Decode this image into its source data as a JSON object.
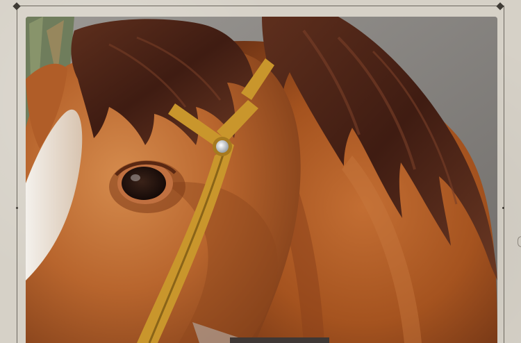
{
  "image": {
    "subject": "horse-head-sculpture",
    "palette": {
      "background": "#d6d1c7",
      "frame": "#6b665d",
      "coat_light": "#c97a3c",
      "coat_mid": "#a85a27",
      "coat_dark": "#5a2a14",
      "mane": "#4a2418",
      "bridle": "#c9962c",
      "wall": "#8f8b87",
      "bottom_bar": "#3f3835"
    }
  }
}
